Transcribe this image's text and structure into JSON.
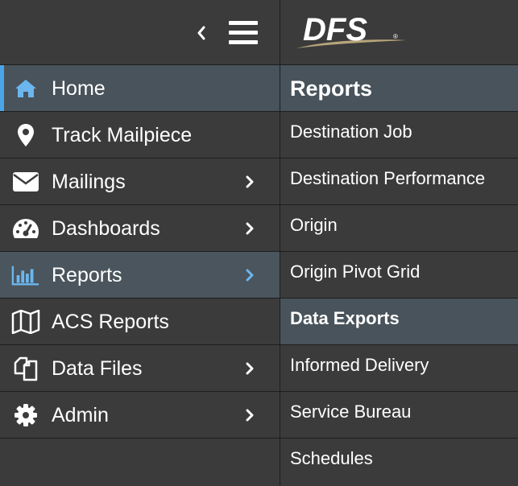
{
  "sidebar": {
    "collapse_icon": "chevron-left-icon",
    "menu_icon": "hamburger-menu-icon",
    "items": [
      {
        "label": "Home",
        "icon": "home-icon"
      },
      {
        "label": "Track Mailpiece",
        "icon": "map-pin-icon"
      },
      {
        "label": "Mailings",
        "icon": "envelope-icon"
      },
      {
        "label": "Dashboards",
        "icon": "gauge-icon"
      },
      {
        "label": "Reports",
        "icon": "bar-chart-icon"
      },
      {
        "label": "ACS Reports",
        "icon": "map-icon"
      },
      {
        "label": "Data Files",
        "icon": "files-icon"
      },
      {
        "label": "Admin",
        "icon": "gear-icon"
      }
    ]
  },
  "brand": {
    "logo_text": "DFS",
    "accent": "#4aa6e8"
  },
  "submenu": {
    "title": "Reports",
    "items": [
      {
        "label": "Destination Job"
      },
      {
        "label": "Destination Performance"
      },
      {
        "label": "Origin"
      },
      {
        "label": "Origin Pivot Grid"
      },
      {
        "label": "Data Exports"
      },
      {
        "label": "Informed Delivery"
      },
      {
        "label": "Service Bureau"
      },
      {
        "label": "Schedules"
      }
    ]
  }
}
